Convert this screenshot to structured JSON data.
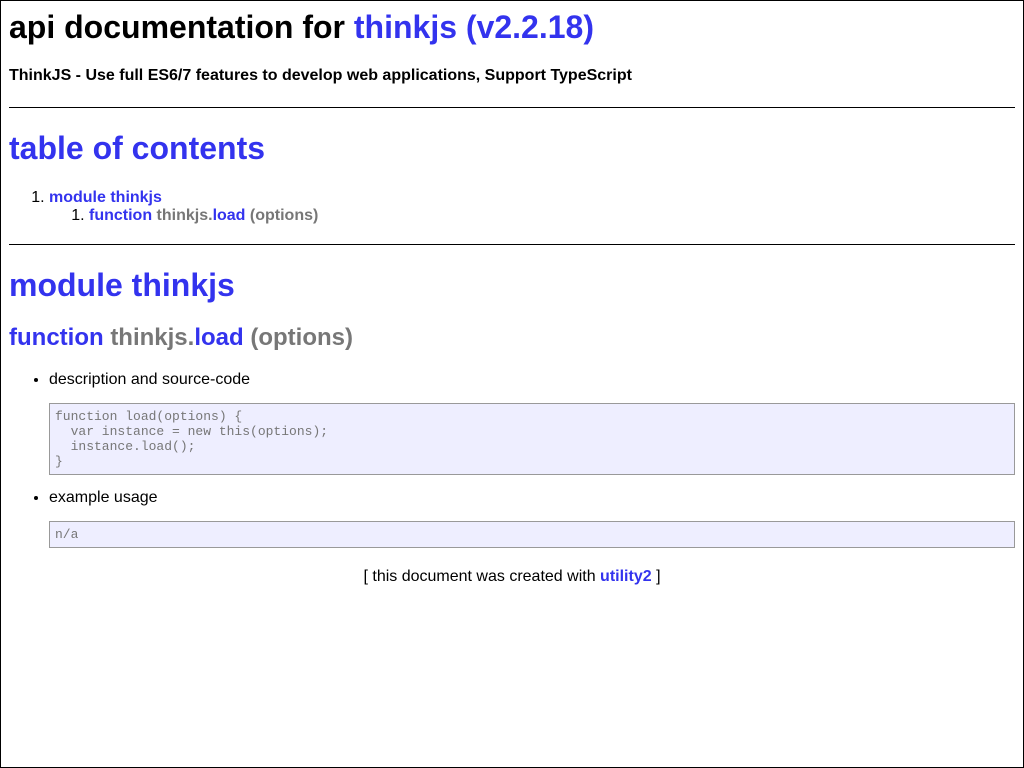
{
  "header": {
    "title_prefix": "api documentation for",
    "title_link": "thinkjs (v2.2.18)",
    "subtitle": "ThinkJS - Use full ES6/7 features to develop web applications, Support TypeScript"
  },
  "toc": {
    "heading": "table of contents",
    "module_label": "module thinkjs",
    "fn_keyword": "function",
    "fn_owner": "thinkjs.",
    "fn_name": "load",
    "fn_args": "(options)"
  },
  "module": {
    "heading": "module thinkjs",
    "fn_keyword": "function",
    "fn_owner": "thinkjs.",
    "fn_name": "load",
    "fn_args": "(options)",
    "desc_label": "description and source-code",
    "source_code": "function load(options) {\n  var instance = new this(options);\n  instance.load();\n}",
    "example_label": "example usage",
    "example_code": "n/a"
  },
  "footer": {
    "prefix": "[ this document was created with",
    "link": "utility2",
    "suffix": "]"
  }
}
